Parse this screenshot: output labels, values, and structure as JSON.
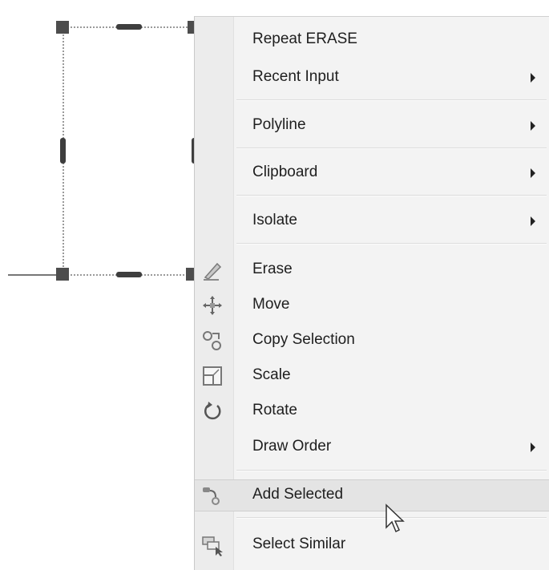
{
  "context_menu": {
    "items": [
      {
        "label": "Repeat ERASE",
        "icon": "",
        "submenu": false
      },
      {
        "label": "Recent Input",
        "icon": "",
        "submenu": true
      },
      {
        "label": "Polyline",
        "icon": "",
        "submenu": true
      },
      {
        "label": "Clipboard",
        "icon": "",
        "submenu": true
      },
      {
        "label": "Isolate",
        "icon": "",
        "submenu": true
      },
      {
        "label": "Erase",
        "icon": "eraser-icon",
        "submenu": false
      },
      {
        "label": "Move",
        "icon": "move-icon",
        "submenu": false
      },
      {
        "label": "Copy Selection",
        "icon": "copy-icon",
        "submenu": false
      },
      {
        "label": "Scale",
        "icon": "scale-icon",
        "submenu": false
      },
      {
        "label": "Rotate",
        "icon": "rotate-icon",
        "submenu": false
      },
      {
        "label": "Draw Order",
        "icon": "",
        "submenu": true
      },
      {
        "label": "Add Selected",
        "icon": "add-selected-icon",
        "submenu": false,
        "highlighted": true
      },
      {
        "label": "Select Similar",
        "icon": "select-similar-icon",
        "submenu": false
      }
    ]
  },
  "colors": {
    "menu_background": "#f3f3f3",
    "highlight": "#e4e4e4",
    "grip": "#4d4d4d"
  }
}
